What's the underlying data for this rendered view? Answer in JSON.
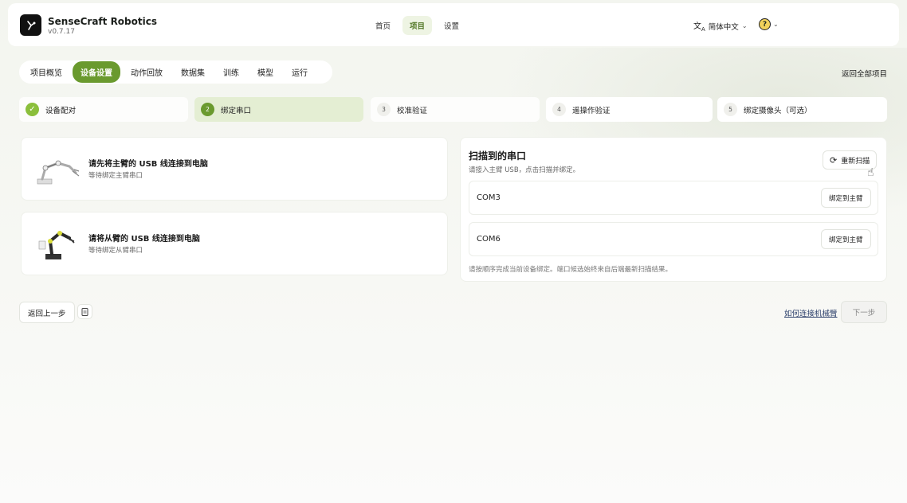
{
  "header": {
    "brand_name": "SenseCraft Robotics",
    "version": "v0.7.17",
    "nav": [
      "首页",
      "项目",
      "设置"
    ],
    "nav_active": "项目",
    "language": "简体中文",
    "help_icon": "question-circle-icon"
  },
  "tabs": {
    "items": [
      "项目概览",
      "设备设置",
      "动作回放",
      "数据集",
      "训练",
      "模型",
      "运行"
    ],
    "active": "设备设置",
    "back_all": "返回全部项目"
  },
  "steps": [
    {
      "num": "",
      "label": "设备配对",
      "state": "done"
    },
    {
      "num": "2",
      "label": "绑定串口",
      "state": "current"
    },
    {
      "num": "3",
      "label": "校准验证",
      "state": "pending"
    },
    {
      "num": "4",
      "label": "遥操作验证",
      "state": "pending"
    },
    {
      "num": "5",
      "label": "绑定摄像头（可选）",
      "state": "pending"
    }
  ],
  "arms": [
    {
      "title": "请先将主臂的 USB 线连接到电脑",
      "sub": "等待绑定主臂串口"
    },
    {
      "title": "请将从臂的 USB 线连接到电脑",
      "sub": "等待绑定从臂串口"
    }
  ],
  "scan": {
    "title": "扫描到的串口",
    "sub": "请接入主臂 USB，点击扫描并绑定。",
    "rescan": "重新扫描",
    "ports": [
      {
        "name": "COM3",
        "action": "绑定到主臂"
      },
      {
        "name": "COM6",
        "action": "绑定到主臂"
      }
    ],
    "note": "请按顺序完成当前设备绑定。端口候选始终来自后端最新扫描结果。"
  },
  "footer": {
    "prev": "返回上一步",
    "how_link": "如何连接机械臂",
    "next": "下一步"
  },
  "colors": {
    "accent": "#6a9a2e",
    "accent_light": "#e4eed3",
    "check": "#8bbf3c"
  }
}
